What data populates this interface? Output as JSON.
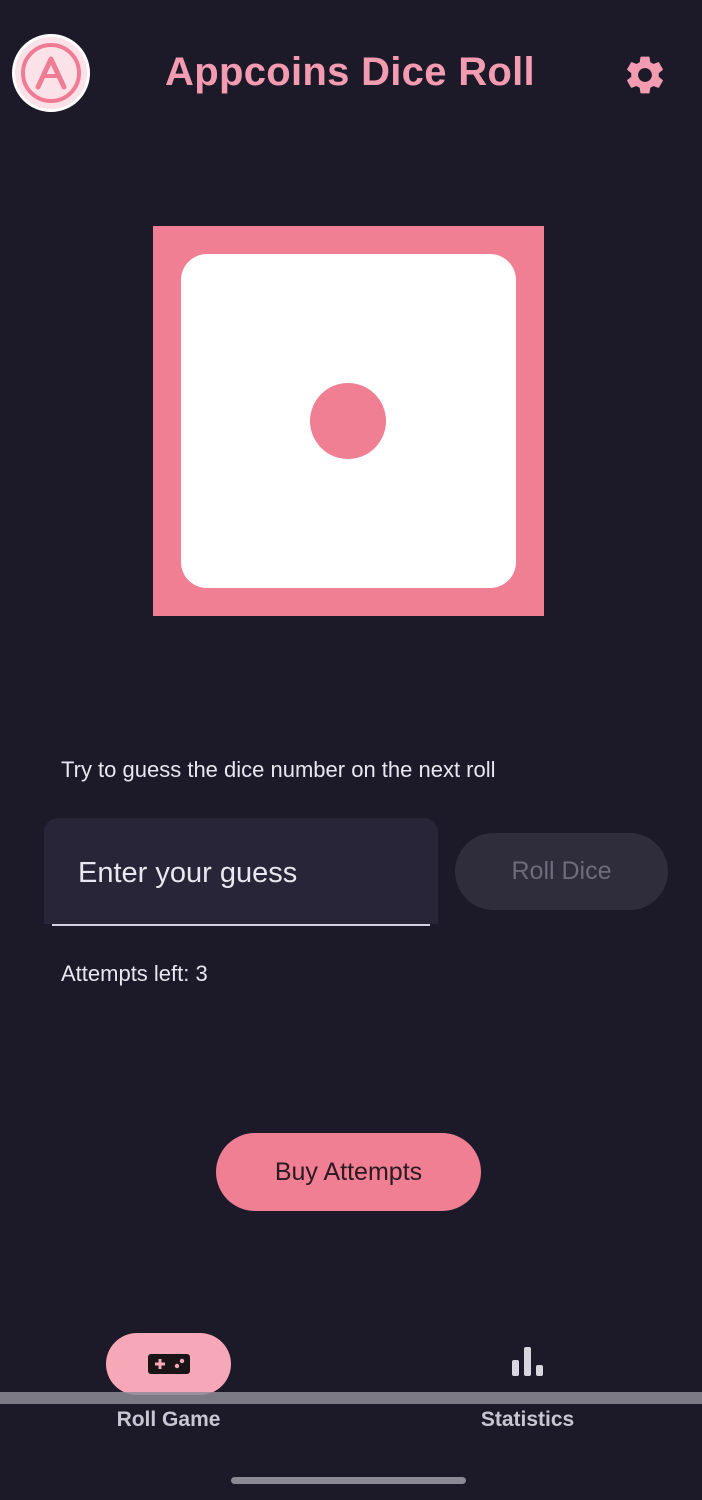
{
  "app": {
    "title": "Appcoins Dice Roll"
  },
  "header": {
    "logo_icon": "appcoins-logo-icon",
    "settings_icon": "gear-icon"
  },
  "dice": {
    "value": 1,
    "frame_color": "#f07f93",
    "face_color": "#ffffff"
  },
  "game": {
    "instruction": "Try to guess the dice number on the next roll",
    "guess_placeholder": "Enter your guess",
    "guess_value": "",
    "roll_label": "Roll Dice",
    "roll_enabled": false,
    "attempts_text": "Attempts left: 3",
    "buy_label": "Buy Attempts"
  },
  "nav": {
    "items": [
      {
        "label": "Roll Game",
        "icon": "gamepad-icon",
        "active": true
      },
      {
        "label": "Statistics",
        "icon": "bar-chart-icon",
        "active": false
      }
    ]
  },
  "colors": {
    "accent": "#f07f93",
    "background": "#1c1a29",
    "title": "#f39bb0"
  }
}
